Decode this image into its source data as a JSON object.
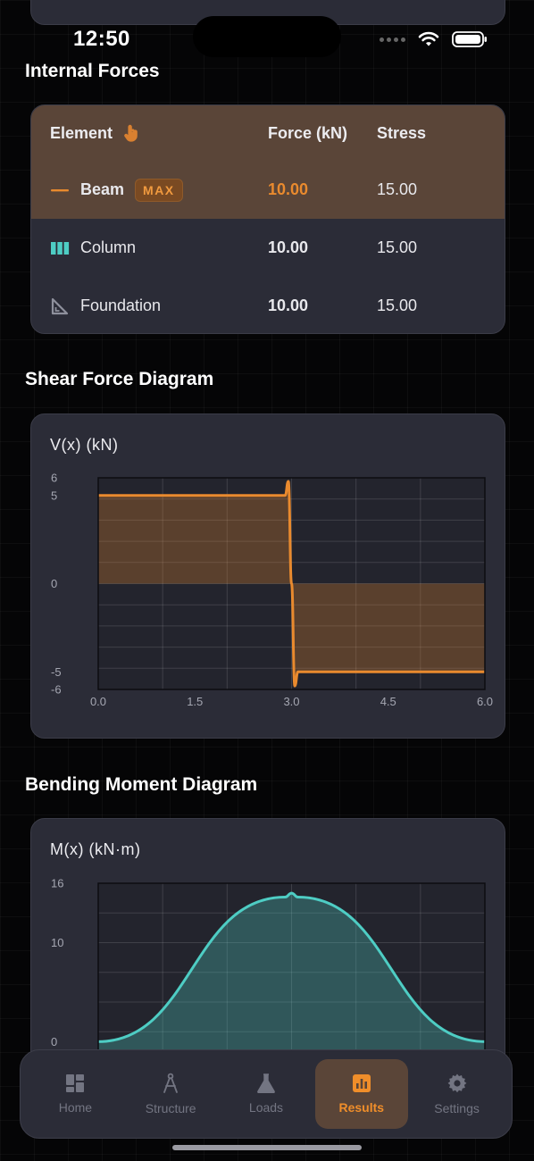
{
  "status": {
    "time": "12:50"
  },
  "sections": {
    "internal_forces": "Internal Forces",
    "shear": "Shear Force Diagram",
    "moment": "Bending Moment Diagram"
  },
  "table": {
    "headers": {
      "element": "Element",
      "force": "Force (kN)",
      "stress": "Stress"
    },
    "rows": [
      {
        "name": "Beam",
        "badge": "MAX",
        "force": "10.00",
        "stress": "15.00",
        "icon": "beam-icon"
      },
      {
        "name": "Column",
        "force": "10.00",
        "stress": "15.00",
        "icon": "column-icon"
      },
      {
        "name": "Foundation",
        "force": "10.00",
        "stress": "15.00",
        "icon": "foundation-icon"
      }
    ]
  },
  "colors": {
    "accent": "#e98a2e",
    "teal": "#4ecdc4",
    "card": "#2b2c37",
    "highlight": "#5a4538"
  },
  "chart_data": [
    {
      "type": "line",
      "title": "V(x) (kN)",
      "xlim": [
        0,
        6
      ],
      "ylim": [
        -6,
        6
      ],
      "xticks": [
        "0.0",
        "1.5",
        "3.0",
        "4.5",
        "6.0"
      ],
      "yticks": [
        "6",
        "5",
        "0",
        "-5",
        "-6"
      ],
      "grid": true,
      "series": [
        {
          "x": [
            0,
            2.9,
            2.95,
            3.0,
            3.05,
            3.1,
            6.0
          ],
          "y": [
            5,
            5,
            5.8,
            0,
            -5.8,
            -5,
            -5
          ]
        }
      ]
    },
    {
      "type": "area",
      "title": "M(x) (kN·m)",
      "xlim": [
        0,
        6
      ],
      "ylim": [
        -8,
        16
      ],
      "yticks": [
        "16",
        "10",
        "0"
      ],
      "grid": true,
      "series": [
        {
          "x": [
            0,
            2.9,
            3.0,
            3.1,
            6.0
          ],
          "y": [
            0,
            14.6,
            15,
            14.6,
            0
          ]
        }
      ]
    }
  ],
  "tabs": [
    {
      "label": "Home",
      "icon": "home-icon",
      "active": false
    },
    {
      "label": "Structure",
      "icon": "compass-icon",
      "active": false
    },
    {
      "label": "Loads",
      "icon": "flask-icon",
      "active": false
    },
    {
      "label": "Results",
      "icon": "chart-icon",
      "active": true
    },
    {
      "label": "Settings",
      "icon": "gear-icon",
      "active": false
    }
  ]
}
